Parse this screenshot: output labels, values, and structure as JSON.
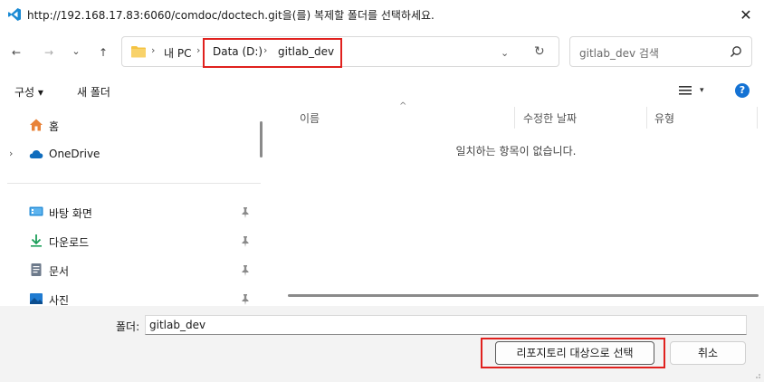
{
  "window": {
    "title": "http://192.168.17.83:6060/comdoc/doctech.git을(를) 복제할 폴더를 선택하세요.",
    "close_glyph": "✕"
  },
  "navigation": {
    "back_glyph": "←",
    "forward_glyph": "→",
    "recent_glyph": "⌄",
    "up_glyph": "↑",
    "breadcrumb": [
      "내 PC",
      "Data (D:)",
      "gitlab_dev"
    ],
    "breadcrumb_sep": "›",
    "dropdown_glyph": "⌄",
    "refresh_glyph": "↻"
  },
  "search": {
    "placeholder": "gitlab_dev 검색"
  },
  "toolbar": {
    "organize_label": "구성 ▾",
    "new_folder_label": "새 폴더",
    "view_chevron": "▾",
    "help_glyph": "?"
  },
  "sidebar": {
    "expand_glyph": "›",
    "items": [
      {
        "label": "홈",
        "icon": "home-icon"
      },
      {
        "label": "OneDrive",
        "icon": "cloud-icon"
      },
      {
        "label": "바탕 화면",
        "icon": "desktop-icon"
      },
      {
        "label": "다운로드",
        "icon": "download-icon"
      },
      {
        "label": "문서",
        "icon": "document-icon"
      },
      {
        "label": "사진",
        "icon": "picture-icon"
      }
    ]
  },
  "file_list": {
    "columns": [
      "이름",
      "수정한 날짜",
      "유형"
    ],
    "sort_caret": "^",
    "empty_message": "일치하는 항목이 없습니다."
  },
  "footer": {
    "folder_label": "폴더:",
    "folder_value": "gitlab_dev",
    "select_button": "리포지토리 대상으로 선택",
    "cancel_button": "취소"
  },
  "colors": {
    "highlight": "#e0211e",
    "accent": "#1472d4",
    "folder": "#f5c342"
  }
}
